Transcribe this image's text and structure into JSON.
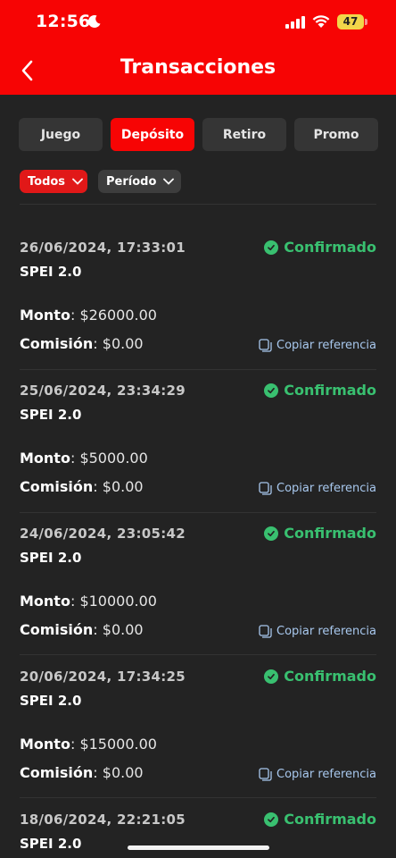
{
  "status_bar": {
    "time": "12:56",
    "battery": "47"
  },
  "header": {
    "title": "Transacciones"
  },
  "tabs": [
    {
      "label": "Juego"
    },
    {
      "label": "Depósito"
    },
    {
      "label": "Retiro"
    },
    {
      "label": "Promo"
    }
  ],
  "active_tab": "Depósito",
  "filters": {
    "status": "Todos",
    "period": "Período"
  },
  "transactions": [
    {
      "datetime": "26/06/2024, 17:33:01",
      "method": "SPEI 2.0",
      "status": "Confirmado",
      "amount_label": "Monto",
      "amount": "$26000.00",
      "fee_label": "Comisión",
      "fee": "$0.00",
      "copy_label": "Copiar referencia"
    },
    {
      "datetime": "25/06/2024, 23:34:29",
      "method": "SPEI 2.0",
      "status": "Confirmado",
      "amount_label": "Monto",
      "amount": "$5000.00",
      "fee_label": "Comisión",
      "fee": "$0.00",
      "copy_label": "Copiar referencia"
    },
    {
      "datetime": "24/06/2024, 23:05:42",
      "method": "SPEI 2.0",
      "status": "Confirmado",
      "amount_label": "Monto",
      "amount": "$10000.00",
      "fee_label": "Comisión",
      "fee": "$0.00",
      "copy_label": "Copiar referencia"
    },
    {
      "datetime": "20/06/2024, 17:34:25",
      "method": "SPEI 2.0",
      "status": "Confirmado",
      "amount_label": "Monto",
      "amount": "$15000.00",
      "fee_label": "Comisión",
      "fee": "$0.00",
      "copy_label": "Copiar referencia"
    },
    {
      "datetime": "18/06/2024, 22:21:05",
      "method": "SPEI 2.0",
      "status": "Confirmado"
    }
  ],
  "icons": {
    "back": "chevron-left-icon",
    "status": "check-circle-icon",
    "copy": "copy-icon",
    "dropdown": "chevron-down-icon"
  },
  "colors": {
    "header": "#f70404",
    "background": "#232323",
    "confirmed": "#39c070",
    "link": "#a8c8ee"
  }
}
